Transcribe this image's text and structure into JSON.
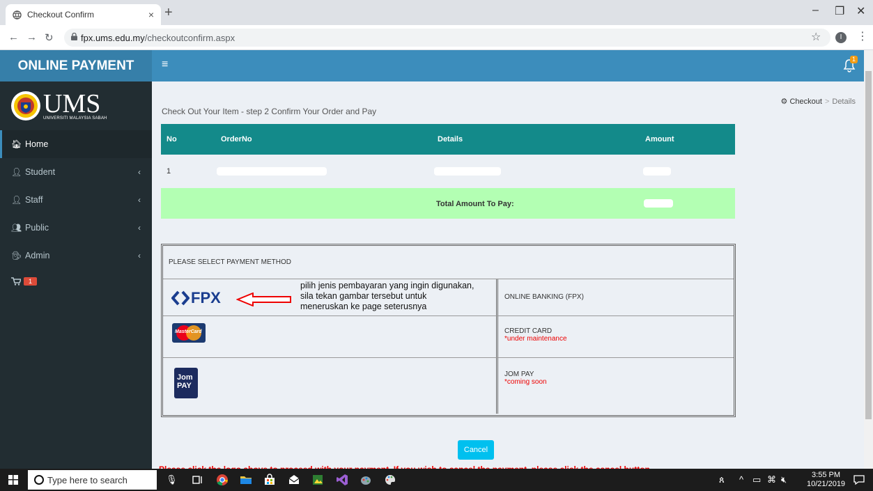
{
  "browser": {
    "tab_title": "Checkout Confirm",
    "tab_close": "×",
    "new_tab": "+",
    "url_host": "fpx.ums.edu.my",
    "url_path": "/checkoutconfirm.aspx",
    "profile_initial": "I"
  },
  "header": {
    "logo": "ONLINE PAYMENT",
    "notification_count": "1"
  },
  "brand": {
    "name": "UMS",
    "sub": "UNIVERSITI MALAYSIA SABAH"
  },
  "sidebar": {
    "items": [
      {
        "label": "Home",
        "icon": "home-icon"
      },
      {
        "label": "Student",
        "icon": "user-icon"
      },
      {
        "label": "Staff",
        "icon": "user-icon"
      },
      {
        "label": "Public",
        "icon": "users-icon"
      },
      {
        "label": "Admin",
        "icon": "user-secret-icon"
      }
    ],
    "cart_count": "1"
  },
  "content": {
    "heading": "Check Out Your Item - step 2 Confirm Your Order and Pay",
    "breadcrumb": {
      "home": "Checkout",
      "current": "Details"
    },
    "table": {
      "columns": [
        "No",
        "OrderNo",
        "Details",
        "Amount"
      ],
      "rows": [
        {
          "no": "1"
        }
      ],
      "total_label": "Total Amount To Pay:"
    },
    "payment": {
      "title": "PLEASE SELECT PAYMENT METHOD",
      "hint": "pilih jenis pembayaran yang ingin digunakan, sila tekan gambar tersebut untuk meneruskan ke page seterusnya",
      "fpx_logo": "FPX",
      "mastercard_logo": "MasterCard",
      "jompay_logo": "Jom PAY",
      "methods": [
        {
          "label": "ONLINE BANKING (FPX)",
          "note": ""
        },
        {
          "label": "CREDIT CARD",
          "note": "*under maintenance"
        },
        {
          "label": "JOM PAY",
          "note": "*coming soon"
        }
      ]
    },
    "cancel_label": "Cancel",
    "bottom_text": "Please click the logo above to proceed with your payment. If you wish to cancel the payment, please click the cancel button"
  },
  "taskbar": {
    "search_placeholder": "Type here to search",
    "time": "3:55 PM",
    "date": "10/21/2019"
  },
  "colors": {
    "header": "#3c8dbc",
    "logo_bg": "#367fa9",
    "sidebar": "#222d32",
    "table_head": "#138a8a",
    "total_row": "#b3ffb3",
    "cancel": "#00c0ef"
  }
}
